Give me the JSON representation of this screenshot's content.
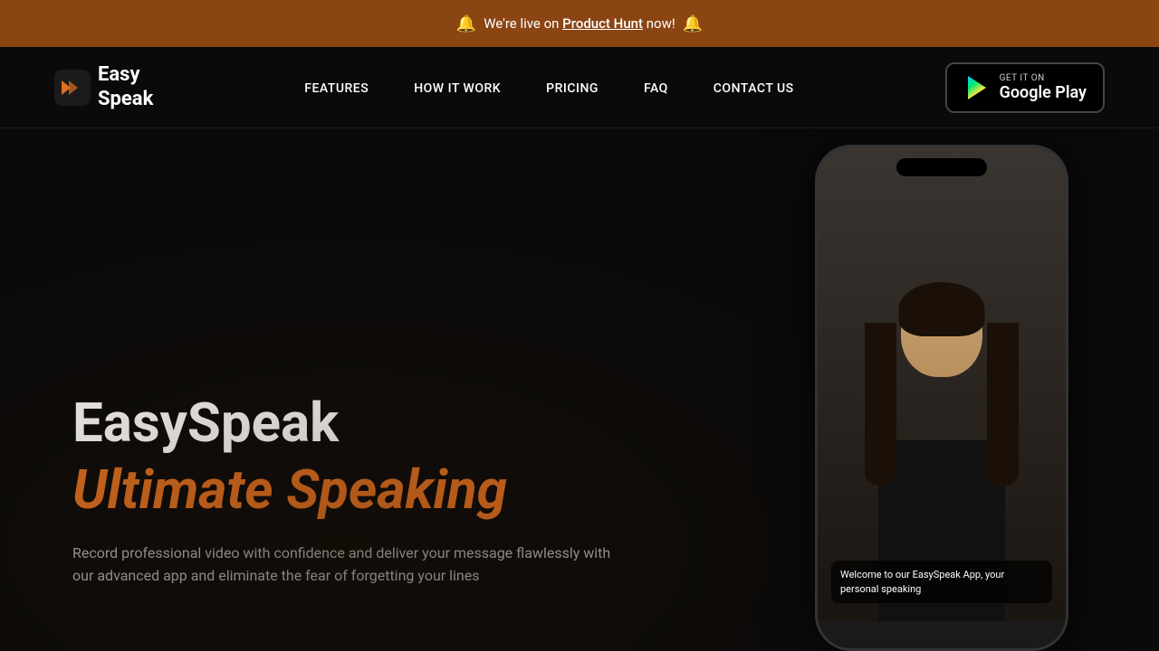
{
  "announcement": {
    "prefix": "We're live on ",
    "link_text": "Product Hunt",
    "suffix": " now!",
    "emoji_left": "🔔",
    "emoji_right": "🔔"
  },
  "navbar": {
    "logo_line1": "Easy",
    "logo_line2": "Speak",
    "nav_items": [
      {
        "label": "FEATURES",
        "href": "#features"
      },
      {
        "label": "HOW IT WORK",
        "href": "#how"
      },
      {
        "label": "PRICING",
        "href": "#pricing"
      },
      {
        "label": "FAQ",
        "href": "#faq"
      },
      {
        "label": "CONTACT US",
        "href": "#contact"
      }
    ],
    "cta_top": "GET IT ON",
    "cta_bottom": "Google Play"
  },
  "hero": {
    "title": "EasySpeak",
    "subtitle": "Ultimate Speaking",
    "description": "Record professional video with confidence and deliver your message flawlessly with our advanced app and eliminate the fear of forgetting your lines"
  },
  "phone": {
    "caption": "Welcome to our EasySpeak App, your personal speaking"
  }
}
